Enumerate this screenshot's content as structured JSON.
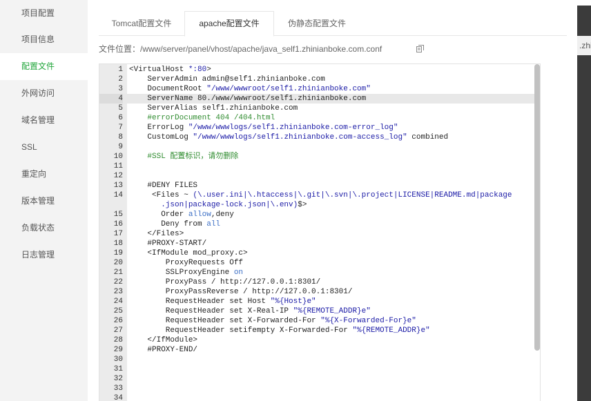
{
  "sidebar": {
    "items": [
      {
        "label": "项目配置",
        "active": false
      },
      {
        "label": "项目信息",
        "active": false
      },
      {
        "label": "配置文件",
        "active": true
      },
      {
        "label": "外网访问",
        "active": false
      },
      {
        "label": "域名管理",
        "active": false
      },
      {
        "label": "SSL",
        "active": false
      },
      {
        "label": "重定向",
        "active": false
      },
      {
        "label": "版本管理",
        "active": false
      },
      {
        "label": "负载状态",
        "active": false
      },
      {
        "label": "日志管理",
        "active": false
      }
    ]
  },
  "tabs": [
    {
      "label": "Tomcat配置文件",
      "active": false
    },
    {
      "label": "apache配置文件",
      "active": true
    },
    {
      "label": "伪静态配置文件",
      "active": false
    }
  ],
  "file_location": {
    "label": "文件位置：",
    "path": "/www/server/panel/vhost/apache/java_self1.zhinianboke.com.conf"
  },
  "background_fragment": ".zhi",
  "editor": {
    "active_line": 4,
    "lines": [
      "<VirtualHost *:80>",
      "    ServerAdmin admin@self1.zhinianboke.com",
      "    DocumentRoot \"/www/wwwroot/self1.zhinianboke.com\"",
      "    ServerName 80./www/wwwroot/self1.zhinianboke.com",
      "    ServerAlias self1.zhinianboke.com",
      "    #errorDocument 404 /404.html",
      "    ErrorLog \"/www/wwwlogs/self1.zhinianboke.com-error_log\"",
      "    CustomLog \"/www/wwwlogs/self1.zhinianboke.com-access_log\" combined",
      "",
      "    #SSL 配置标识，请勿删除",
      "",
      "",
      "    #DENY FILES",
      "     <Files ~ (\\.user.ini|\\.htaccess|\\.git|\\.svn|\\.project|LICENSE|README.md|package.json|package-lock.json|\\.env)$>",
      "       Order allow,deny",
      "       Deny from all",
      "    </Files>",
      "    #PROXY-START/",
      "    <IfModule mod_proxy.c>",
      "        ProxyRequests Off",
      "        SSLProxyEngine on",
      "        ProxyPass / http://127.0.0.1:8301/",
      "        ProxyPassReverse / http://127.0.0.1:8301/",
      "        RequestHeader set Host \"%{Host}e\"",
      "        RequestHeader set X-Real-IP \"%{REMOTE_ADDR}e\"",
      "        RequestHeader set X-Forwarded-For \"%{X-Forwarded-For}e\"",
      "        RequestHeader setifempty X-Forwarded-For \"%{REMOTE_ADDR}e\"",
      "    </IfModule>",
      "    #PROXY-END/",
      "",
      "",
      "",
      "",
      ""
    ]
  },
  "colors": {
    "accent": "#20a53a",
    "string": "#1a1aa6",
    "comment": "#2e8b2e",
    "keyword": "#3c6fc5",
    "sidebar_bg": "#f3f3f3",
    "gutter_bg": "#ebebeb"
  },
  "icons": {
    "copy": "copy-icon"
  }
}
